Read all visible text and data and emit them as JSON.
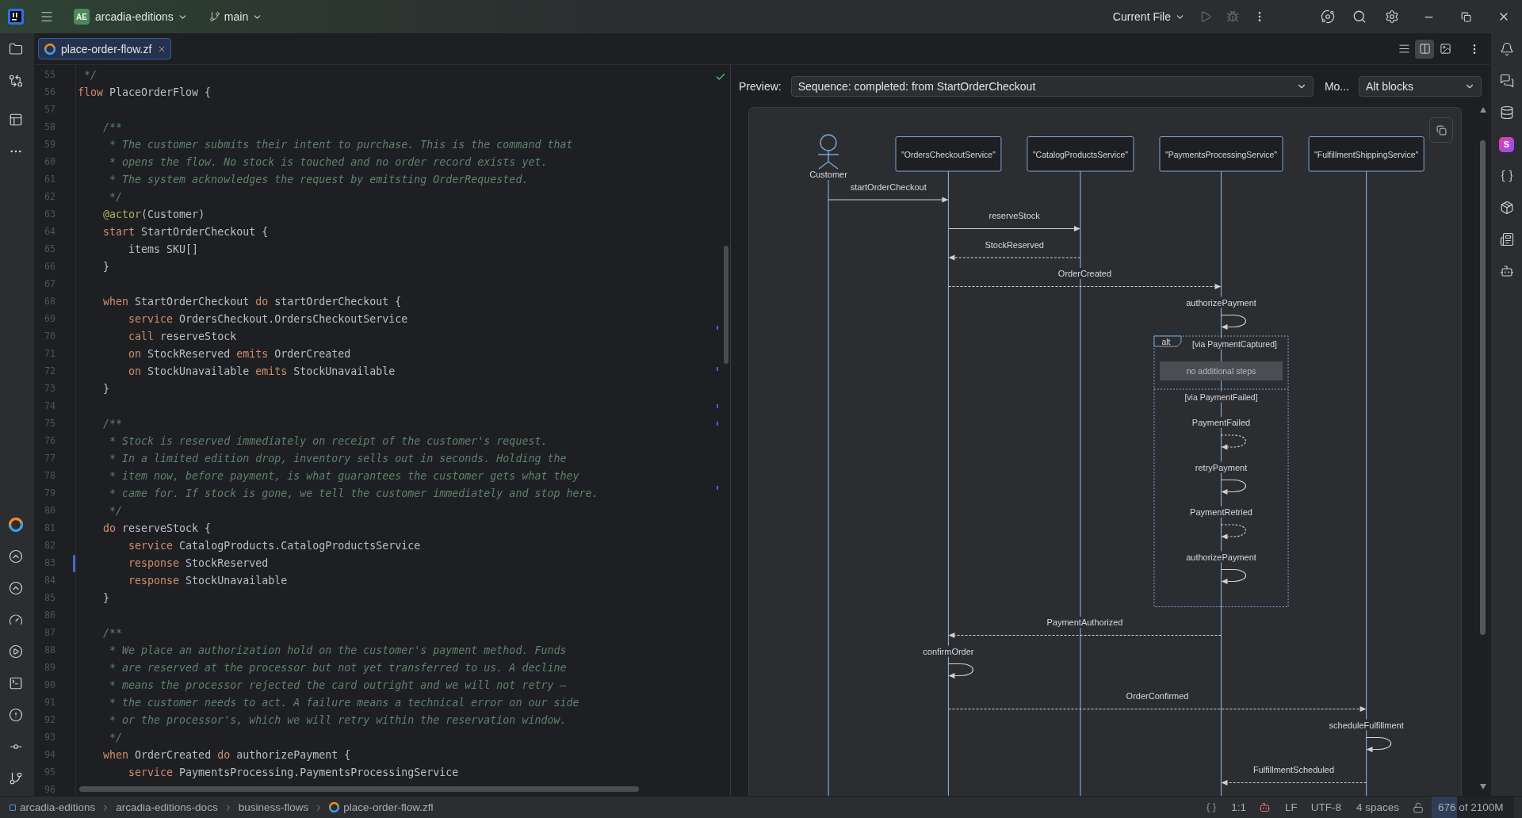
{
  "title_bar": {
    "project_badge": "AE",
    "project": "arcadia-editions",
    "branch": "main",
    "run_config": "Current File"
  },
  "right_toolbar": {
    "plugin_badge": "S"
  },
  "tabs": [
    {
      "label": "place-order-flow.zf",
      "selected": true
    }
  ],
  "view_modes": [
    {
      "kind": "editor",
      "selected": false
    },
    {
      "kind": "split",
      "selected": true
    },
    {
      "kind": "preview",
      "selected": false
    }
  ],
  "editor": {
    "lines": [
      {
        "number": "55",
        "modified": false,
        "tokens": [
          {
            "kind": "comment",
            "text": " */"
          }
        ]
      },
      {
        "number": "56",
        "modified": false,
        "tokens": [
          {
            "kind": "keyword",
            "text": "flow"
          },
          {
            "kind": "plain",
            "text": " PlaceOrderFlow {"
          }
        ]
      },
      {
        "number": "57",
        "modified": false
      },
      {
        "number": "58",
        "modified": false,
        "tokens": [
          {
            "kind": "comment",
            "text": "    /**"
          }
        ]
      },
      {
        "number": "59",
        "modified": false,
        "tokens": [
          {
            "kind": "comment",
            "text": "     * The customer submits their intent to purchase. This is the command that"
          }
        ]
      },
      {
        "number": "60",
        "modified": false,
        "tokens": [
          {
            "kind": "comment",
            "text": "     * opens the flow. No stock is touched and no order record exists yet."
          }
        ]
      },
      {
        "number": "61",
        "modified": false,
        "tokens": [
          {
            "kind": "comment",
            "text": "     * The system acknowledges the request by emitsting OrderRequested."
          }
        ]
      },
      {
        "number": "62",
        "modified": false,
        "tokens": [
          {
            "kind": "comment",
            "text": "     */"
          }
        ]
      },
      {
        "number": "63",
        "modified": false,
        "tokens": [
          {
            "kind": "annotation",
            "text": "    @actor"
          },
          {
            "kind": "plain",
            "text": "(Customer)"
          }
        ]
      },
      {
        "number": "64",
        "modified": false,
        "tokens": [
          {
            "kind": "keyword",
            "text": "    start"
          },
          {
            "kind": "plain",
            "text": " StartOrderCheckout {"
          }
        ]
      },
      {
        "number": "65",
        "modified": false,
        "tokens": [
          {
            "kind": "plain",
            "text": "        items SKU[]"
          }
        ]
      },
      {
        "number": "66",
        "modified": false,
        "tokens": [
          {
            "kind": "plain",
            "text": "    }"
          }
        ]
      },
      {
        "number": "67",
        "modified": false
      },
      {
        "number": "68",
        "modified": false,
        "tokens": [
          {
            "kind": "keyword",
            "text": "    when"
          },
          {
            "kind": "plain",
            "text": " StartOrderCheckout "
          },
          {
            "kind": "keyword",
            "text": "do"
          },
          {
            "kind": "plain",
            "text": " startOrderCheckout {"
          }
        ]
      },
      {
        "number": "69",
        "modified": false,
        "tokens": [
          {
            "kind": "keyword",
            "text": "        service"
          },
          {
            "kind": "plain",
            "text": " OrdersCheckout.OrdersCheckoutService"
          }
        ]
      },
      {
        "number": "70",
        "modified": false,
        "tokens": [
          {
            "kind": "keyword",
            "text": "        call"
          },
          {
            "kind": "plain",
            "text": " reserveStock"
          }
        ]
      },
      {
        "number": "71",
        "modified": false,
        "tokens": [
          {
            "kind": "keyword",
            "text": "        on"
          },
          {
            "kind": "plain",
            "text": " StockReserved "
          },
          {
            "kind": "keyword",
            "text": "emits"
          },
          {
            "kind": "plain",
            "text": " OrderCreated"
          }
        ]
      },
      {
        "number": "72",
        "modified": false,
        "tokens": [
          {
            "kind": "keyword",
            "text": "        on"
          },
          {
            "kind": "plain",
            "text": " StockUnavailable "
          },
          {
            "kind": "keyword",
            "text": "emits"
          },
          {
            "kind": "plain",
            "text": " StockUnavailable"
          }
        ]
      },
      {
        "number": "73",
        "modified": false,
        "tokens": [
          {
            "kind": "plain",
            "text": "    }"
          }
        ]
      },
      {
        "number": "74",
        "modified": false
      },
      {
        "number": "75",
        "modified": false,
        "tokens": [
          {
            "kind": "comment",
            "text": "    /**"
          }
        ]
      },
      {
        "number": "76",
        "modified": false,
        "tokens": [
          {
            "kind": "comment",
            "text": "     * Stock is reserved immediately on receipt of the customer's request."
          }
        ]
      },
      {
        "number": "77",
        "modified": false,
        "tokens": [
          {
            "kind": "comment",
            "text": "     * In a limited edition drop, inventory sells out in seconds. Holding the"
          }
        ]
      },
      {
        "number": "78",
        "modified": false,
        "tokens": [
          {
            "kind": "comment",
            "text": "     * item now, before payment, is what guarantees the customer gets what they"
          }
        ]
      },
      {
        "number": "79",
        "modified": false,
        "tokens": [
          {
            "kind": "comment",
            "text": "     * came for. If stock is gone, we tell the customer immediately and stop here."
          }
        ]
      },
      {
        "number": "80",
        "modified": false,
        "tokens": [
          {
            "kind": "comment",
            "text": "     */"
          }
        ]
      },
      {
        "number": "81",
        "modified": false,
        "tokens": [
          {
            "kind": "keyword",
            "text": "    do"
          },
          {
            "kind": "plain",
            "text": " reserveStock {"
          }
        ]
      },
      {
        "number": "82",
        "modified": false,
        "tokens": [
          {
            "kind": "keyword",
            "text": "        service"
          },
          {
            "kind": "plain",
            "text": " CatalogProducts.CatalogProductsService"
          }
        ]
      },
      {
        "number": "83",
        "modified": true,
        "tokens": [
          {
            "kind": "keyword",
            "text": "        response"
          },
          {
            "kind": "plain",
            "text": " StockReserved"
          }
        ]
      },
      {
        "number": "84",
        "modified": false,
        "tokens": [
          {
            "kind": "keyword",
            "text": "        response"
          },
          {
            "kind": "plain",
            "text": " StockUnavailable"
          }
        ]
      },
      {
        "number": "85",
        "modified": false,
        "tokens": [
          {
            "kind": "plain",
            "text": "    }"
          }
        ]
      },
      {
        "number": "86",
        "modified": false
      },
      {
        "number": "87",
        "modified": false,
        "tokens": [
          {
            "kind": "comment",
            "text": "    /**"
          }
        ]
      },
      {
        "number": "88",
        "modified": false,
        "tokens": [
          {
            "kind": "comment",
            "text": "     * We place an authorization hold on the customer's payment method. Funds"
          }
        ]
      },
      {
        "number": "89",
        "modified": false,
        "tokens": [
          {
            "kind": "comment",
            "text": "     * are reserved at the processor but not yet transferred to us. A decline"
          }
        ]
      },
      {
        "number": "90",
        "modified": false,
        "tokens": [
          {
            "kind": "comment",
            "text": "     * means the processor rejected the card outright and we will not retry —"
          }
        ]
      },
      {
        "number": "91",
        "modified": false,
        "tokens": [
          {
            "kind": "comment",
            "text": "     * the customer needs to act. A failure means a technical error on our side"
          }
        ]
      },
      {
        "number": "92",
        "modified": false,
        "tokens": [
          {
            "kind": "comment",
            "text": "     * or the processor's, which we will retry within the reservation window."
          }
        ]
      },
      {
        "number": "93",
        "modified": false,
        "tokens": [
          {
            "kind": "comment",
            "text": "     */"
          }
        ]
      },
      {
        "number": "94",
        "modified": false,
        "tokens": [
          {
            "kind": "keyword",
            "text": "    when"
          },
          {
            "kind": "plain",
            "text": " OrderCreated "
          },
          {
            "kind": "keyword",
            "text": "do"
          },
          {
            "kind": "plain",
            "text": " authorizePayment {"
          }
        ]
      },
      {
        "number": "95",
        "modified": false,
        "tokens": [
          {
            "kind": "keyword",
            "text": "        service"
          },
          {
            "kind": "plain",
            "text": " PaymentsProcessing.PaymentsProcessingService"
          }
        ]
      },
      {
        "number": "96",
        "modified": false
      }
    ]
  },
  "preview": {
    "label": "Preview:",
    "scenario": "Sequence: completed: from StartOrderCheckout",
    "mode_label": "Mo...",
    "mode": "Alt blocks",
    "diagram": {
      "participants": [
        {
          "kind": "actor",
          "name": "Customer"
        },
        {
          "kind": "service",
          "name": "\"OrdersCheckoutService\""
        },
        {
          "kind": "service",
          "name": "\"CatalogProductsService\""
        },
        {
          "kind": "service",
          "name": "\"PaymentsProcessingService\""
        },
        {
          "kind": "service",
          "name": "\"FulfillmentShippingService\""
        }
      ],
      "steps": [
        {
          "kind": "message",
          "label": "startOrderCheckout",
          "dashed": false
        },
        {
          "kind": "message",
          "label": "reserveStock",
          "dashed": false
        },
        {
          "kind": "message",
          "label": "StockReserved",
          "dashed": true
        },
        {
          "kind": "message",
          "label": "OrderCreated",
          "dashed": true
        },
        {
          "kind": "self",
          "label": "authorizePayment",
          "dashed": false
        },
        {
          "kind": "alt",
          "tag": "alt",
          "branches": [
            {
              "guard": "[via PaymentCaptured]",
              "placeholder": "no additional steps"
            },
            {
              "guard": "[via PaymentFailed]",
              "steps": [
                {
                  "kind": "self",
                  "label": "PaymentFailed",
                  "dashed": true
                },
                {
                  "kind": "self",
                  "label": "retryPayment",
                  "dashed": false
                },
                {
                  "kind": "self",
                  "label": "PaymentRetried",
                  "dashed": true
                },
                {
                  "kind": "self",
                  "label": "authorizePayment",
                  "dashed": false
                }
              ]
            }
          ]
        },
        {
          "kind": "message",
          "label": "PaymentAuthorized",
          "dashed": true
        },
        {
          "kind": "self",
          "label": "confirmOrder",
          "dashed": false
        },
        {
          "kind": "message",
          "label": "OrderConfirmed",
          "dashed": true
        },
        {
          "kind": "self",
          "label": "scheduleFulfillment",
          "dashed": false
        },
        {
          "kind": "message",
          "label": "FulfillmentScheduled",
          "dashed": true
        }
      ]
    }
  },
  "status_bar": {
    "breadcrumbs": [
      {
        "kind": "module",
        "label": "arcadia-editions"
      },
      {
        "kind": "folder",
        "label": "arcadia-editions-docs"
      },
      {
        "kind": "folder",
        "label": "business-flows"
      },
      {
        "kind": "file",
        "label": "place-order-flow.zfl"
      }
    ],
    "position": "1:1",
    "line_separator": "LF",
    "encoding": "UTF-8",
    "indent": "4 spaces",
    "memory": {
      "text": "676 of 2100M",
      "level": 0.31
    }
  }
}
